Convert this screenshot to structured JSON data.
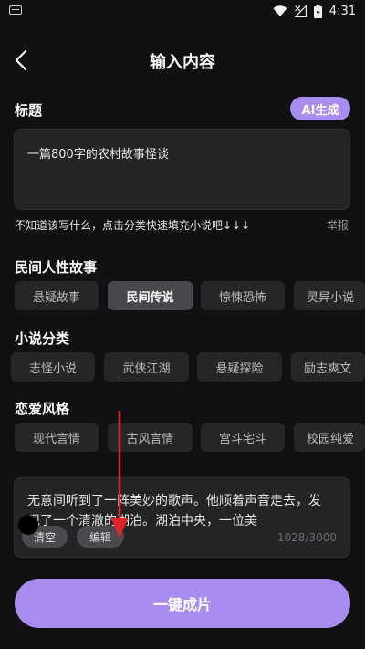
{
  "status_bar": {
    "time": "4:31",
    "icons": [
      "notification-icon",
      "wifi-icon",
      "signal-icon",
      "battery-icon"
    ]
  },
  "header": {
    "title": "输入内容",
    "back_icon": "chevron-left-icon"
  },
  "title_section": {
    "label": "标题",
    "ai_button": "AI生成",
    "value": "一篇800字的农村故事怪谈",
    "hint": "不知道该写什么，点击分类快速填充小说吧↓↓↓",
    "report": "举报"
  },
  "categories": [
    {
      "label": "民间人性故事",
      "chips": [
        "悬疑故事",
        "民间传说",
        "惊悚恐怖",
        "灵异小说"
      ],
      "active": 1
    },
    {
      "label": "小说分类",
      "chips": [
        "志怪小说",
        "武侠江湖",
        "悬疑探险",
        "励志爽文"
      ],
      "active": -1
    },
    {
      "label": "恋爱风格",
      "chips": [
        "现代言情",
        "古风言情",
        "宫斗宅斗",
        "校园纯爱"
      ],
      "active": -1
    }
  ],
  "content": {
    "text": "无意间听到了一阵美妙的歌声。他顺着声音走去，发现了一个清澈的湖泊。湖泊中央，一位美",
    "clear_button": "清空",
    "edit_button": "编辑",
    "counter": "1028/3000"
  },
  "primary_button": "一键成片",
  "colors": {
    "accent": "#a98cf0",
    "background": "#111113",
    "surface": "#242426",
    "annotation_arrow": "#e0242a"
  }
}
